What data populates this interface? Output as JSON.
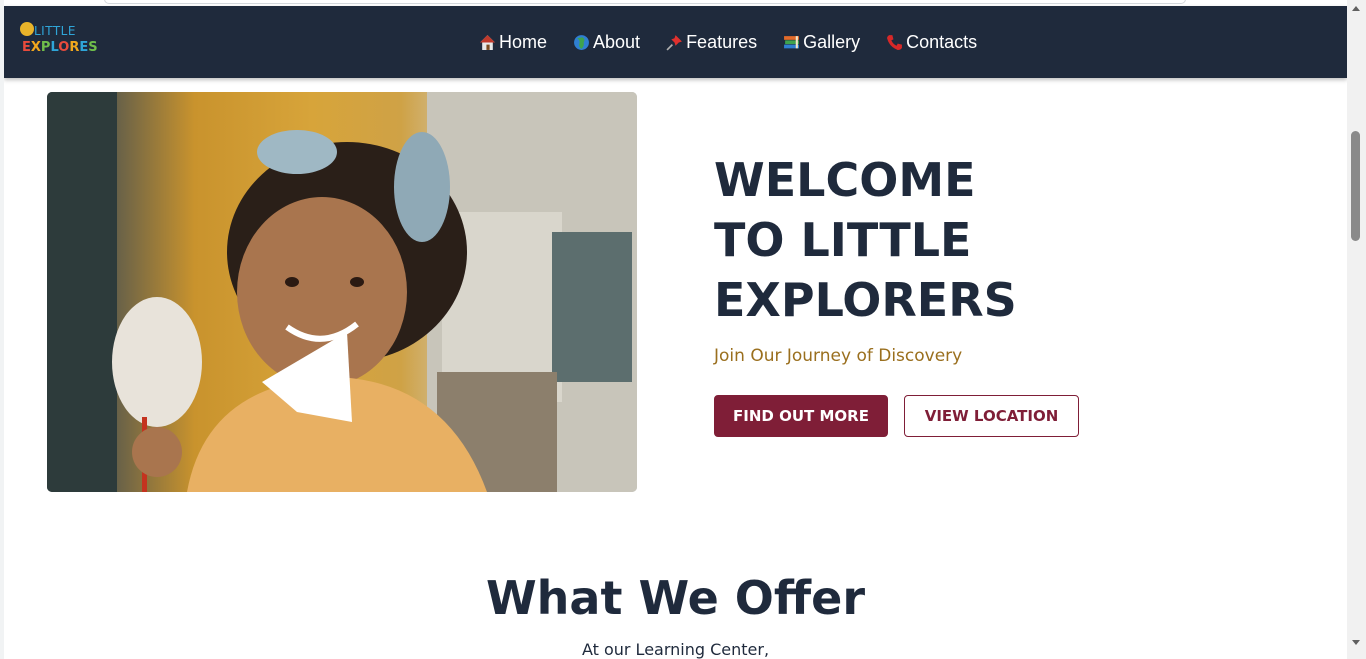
{
  "navbar": {
    "logo": {
      "line1": "LITTLE",
      "line2_letters": [
        {
          "ch": "E",
          "color": "#e94b3c"
        },
        {
          "ch": "X",
          "color": "#f2a81d"
        },
        {
          "ch": "P",
          "color": "#6fbf4b"
        },
        {
          "ch": "L",
          "color": "#2fa5d8"
        },
        {
          "ch": "O",
          "color": "#e94b3c"
        },
        {
          "ch": "R",
          "color": "#f2a81d"
        },
        {
          "ch": "E",
          "color": "#2fa5d8"
        },
        {
          "ch": "S",
          "color": "#6fbf4b"
        }
      ]
    },
    "links": [
      {
        "label": "Home",
        "icon": "house-icon"
      },
      {
        "label": "About",
        "icon": "globe-icon"
      },
      {
        "label": "Features",
        "icon": "pushpin-icon"
      },
      {
        "label": "Gallery",
        "icon": "books-icon"
      },
      {
        "label": "Contacts",
        "icon": "telephone-icon"
      }
    ]
  },
  "hero": {
    "image_alt": "Smiling girl holding a paintbrush",
    "title_lines": [
      "WELCOME",
      "TO LITTLE",
      "EXPLORERS"
    ],
    "subtitle": "Join Our Journey of Discovery",
    "primary_button": "FIND OUT MORE",
    "secondary_button": "VIEW LOCATION"
  },
  "offer": {
    "title": "What We Offer",
    "subtitle": "At our Learning Center,"
  },
  "colors": {
    "nav_bg": "#1f2a3c",
    "accent": "#7f1e37",
    "subtitle": "#9a6f1e",
    "heading": "#1f2a3c"
  }
}
